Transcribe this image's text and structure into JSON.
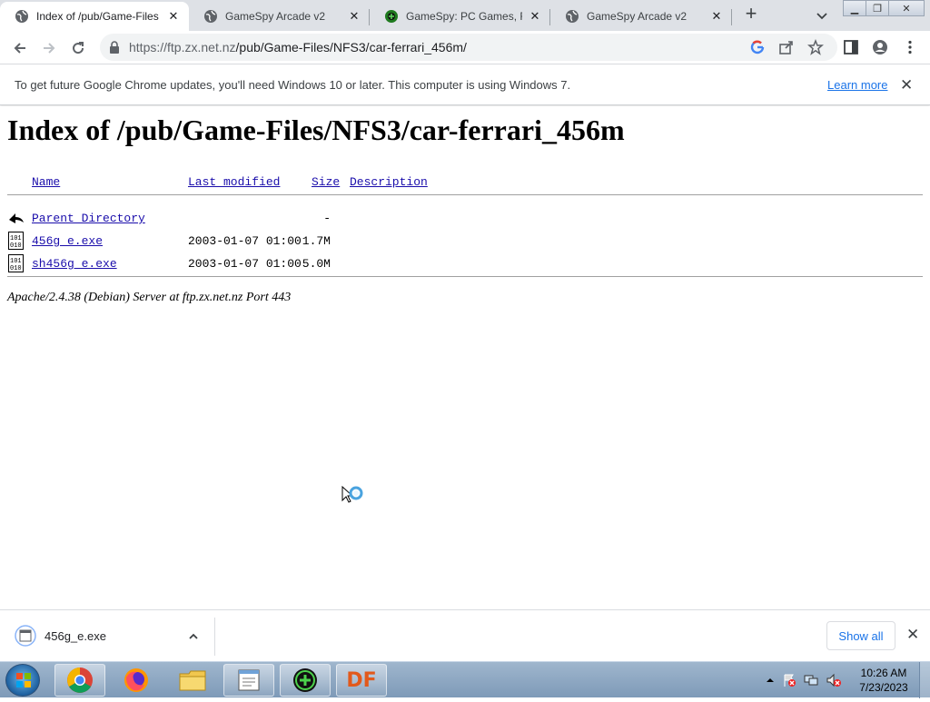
{
  "browser": {
    "tabs": [
      {
        "title": "Index of /pub/Game-Files",
        "active": true,
        "icon": "globe-icon"
      },
      {
        "title": "GameSpy Arcade v2",
        "active": false,
        "icon": "globe-icon"
      },
      {
        "title": "GameSpy: PC Games, Rev",
        "active": false,
        "icon": "gamespy-icon"
      },
      {
        "title": "GameSpy Arcade v2",
        "active": false,
        "icon": "globe-icon"
      }
    ],
    "new_tab_label": "+",
    "url_host": "https://ftp.zx.net.nz",
    "url_path": "/pub/Game-Files/NFS3/car-ferrari_456m/"
  },
  "infobar": {
    "message": "To get future Google Chrome updates, you'll need Windows 10 or later. This computer is using Windows 7.",
    "link": "Learn more",
    "close": "✕"
  },
  "page": {
    "heading": "Index of /pub/Game-Files/NFS3/car-ferrari_456m",
    "columns": {
      "name": "Name",
      "modified": "Last modified",
      "size": "Size",
      "description": "Description"
    },
    "rows": [
      {
        "name": "Parent Directory",
        "modified": "",
        "size": "-",
        "icon": "back-arrow-icon"
      },
      {
        "name": "456g_e.exe",
        "modified": "2003-01-07 01:00",
        "size": "1.7M",
        "icon": "binary-file-icon"
      },
      {
        "name": "sh456g_e.exe",
        "modified": "2003-01-07 01:00",
        "size": "5.0M",
        "icon": "binary-file-icon"
      }
    ],
    "footer": "Apache/2.4.38 (Debian) Server at ftp.zx.net.nz Port 443"
  },
  "downloads": {
    "item": "456g_e.exe",
    "show_all": "Show all",
    "close": "✕"
  },
  "taskbar": {
    "apps": [
      "chrome-icon",
      "firefox-icon",
      "explorer-icon",
      "notepad-icon",
      "gamespy-icon",
      "df-icon"
    ],
    "df_label": "DF",
    "time": "10:26 AM",
    "date": "7/23/2023"
  },
  "colors": {
    "link": "#1a0dab",
    "accent": "#1a73e8",
    "tabstrip": "#dee1e6"
  }
}
